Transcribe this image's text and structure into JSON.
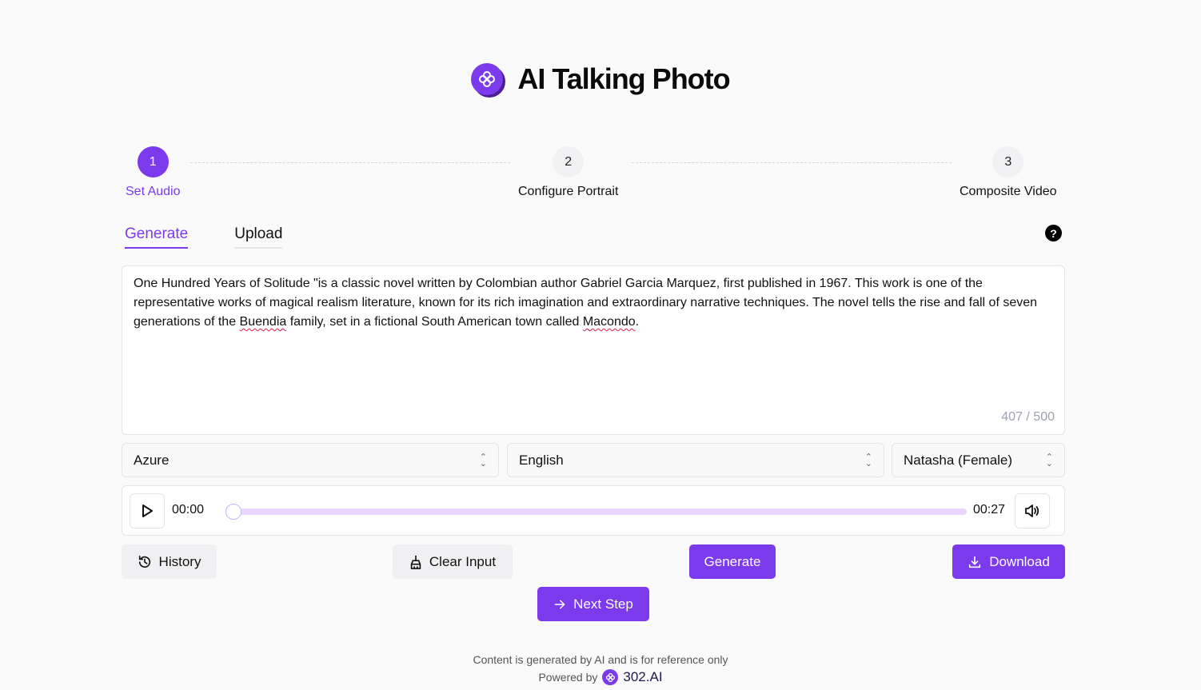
{
  "header": {
    "title": "AI Talking Photo",
    "logo_icon": "flower-icon",
    "accent": "#7c3aed"
  },
  "steps": [
    {
      "number": "1",
      "label": "Set Audio",
      "active": true
    },
    {
      "number": "2",
      "label": "Configure Portrait",
      "active": false
    },
    {
      "number": "3",
      "label": "Composite Video",
      "active": false
    }
  ],
  "tabs": [
    {
      "label": "Generate",
      "active": true
    },
    {
      "label": "Upload",
      "active": false
    }
  ],
  "help": {
    "label": "?"
  },
  "input": {
    "text_before_1": "One Hundred Years of Solitude \"is a classic novel written by Colombian author Gabriel Garcia Marquez, first published in 1967. This work is one of the representative works of magical realism literature, known for its rich imagination and extraordinary narrative techniques. The novel tells the rise and fall of seven generations of the ",
    "misspelled_1": "Buendia",
    "text_between": " family, set in a fictional South American town called ",
    "misspelled_2": "Macondo",
    "text_end": ".",
    "counter": "407 / 500"
  },
  "selects": {
    "provider": "Azure",
    "language": "English",
    "voice": "Natasha (Female)"
  },
  "player": {
    "current_time": "00:00",
    "duration": "00:27",
    "progress": 0
  },
  "actions": {
    "history": "History",
    "clear": "Clear Input",
    "generate": "Generate",
    "download": "Download",
    "next": "Next Step"
  },
  "footer": {
    "note": "Content is generated by AI and is for reference only",
    "powered_by": "Powered by",
    "brand": "302.AI"
  }
}
